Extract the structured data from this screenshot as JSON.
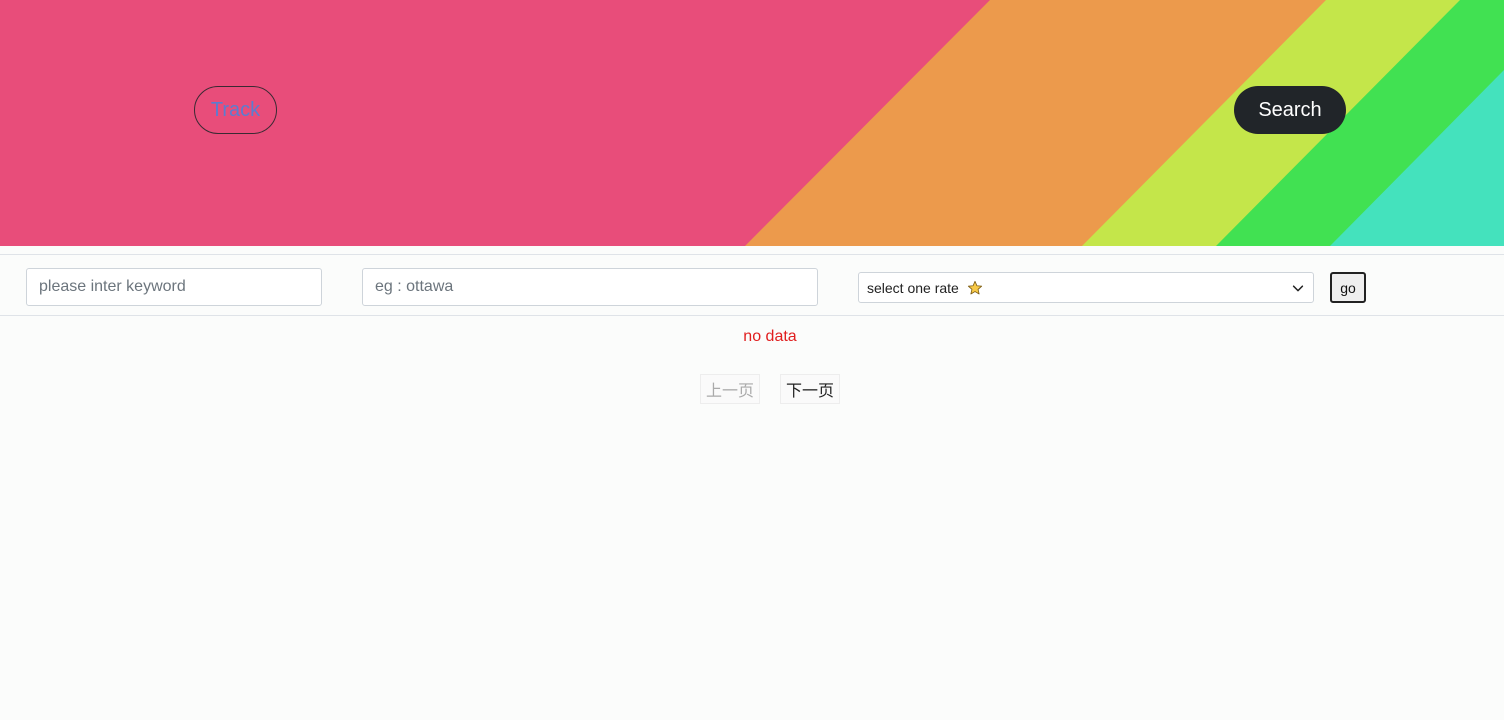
{
  "header": {
    "track_label": "Track",
    "search_label": "Search",
    "colors": {
      "pink": "#e84d7a",
      "orange": "#ec9a4c",
      "lime": "#c4e64a",
      "green": "#41e152",
      "aqua": "#44e2bd",
      "button_dark": "#212529"
    }
  },
  "filters": {
    "keyword_placeholder": "please inter keyword",
    "keyword_value": "",
    "city_placeholder": "eg : ottawa",
    "city_value": "",
    "rate_selected": "select one rate",
    "rate_icon": "star-icon",
    "go_label": "go"
  },
  "results": {
    "empty_message": "no data"
  },
  "pagination": {
    "prev_label": "上一页",
    "next_label": "下一页"
  }
}
